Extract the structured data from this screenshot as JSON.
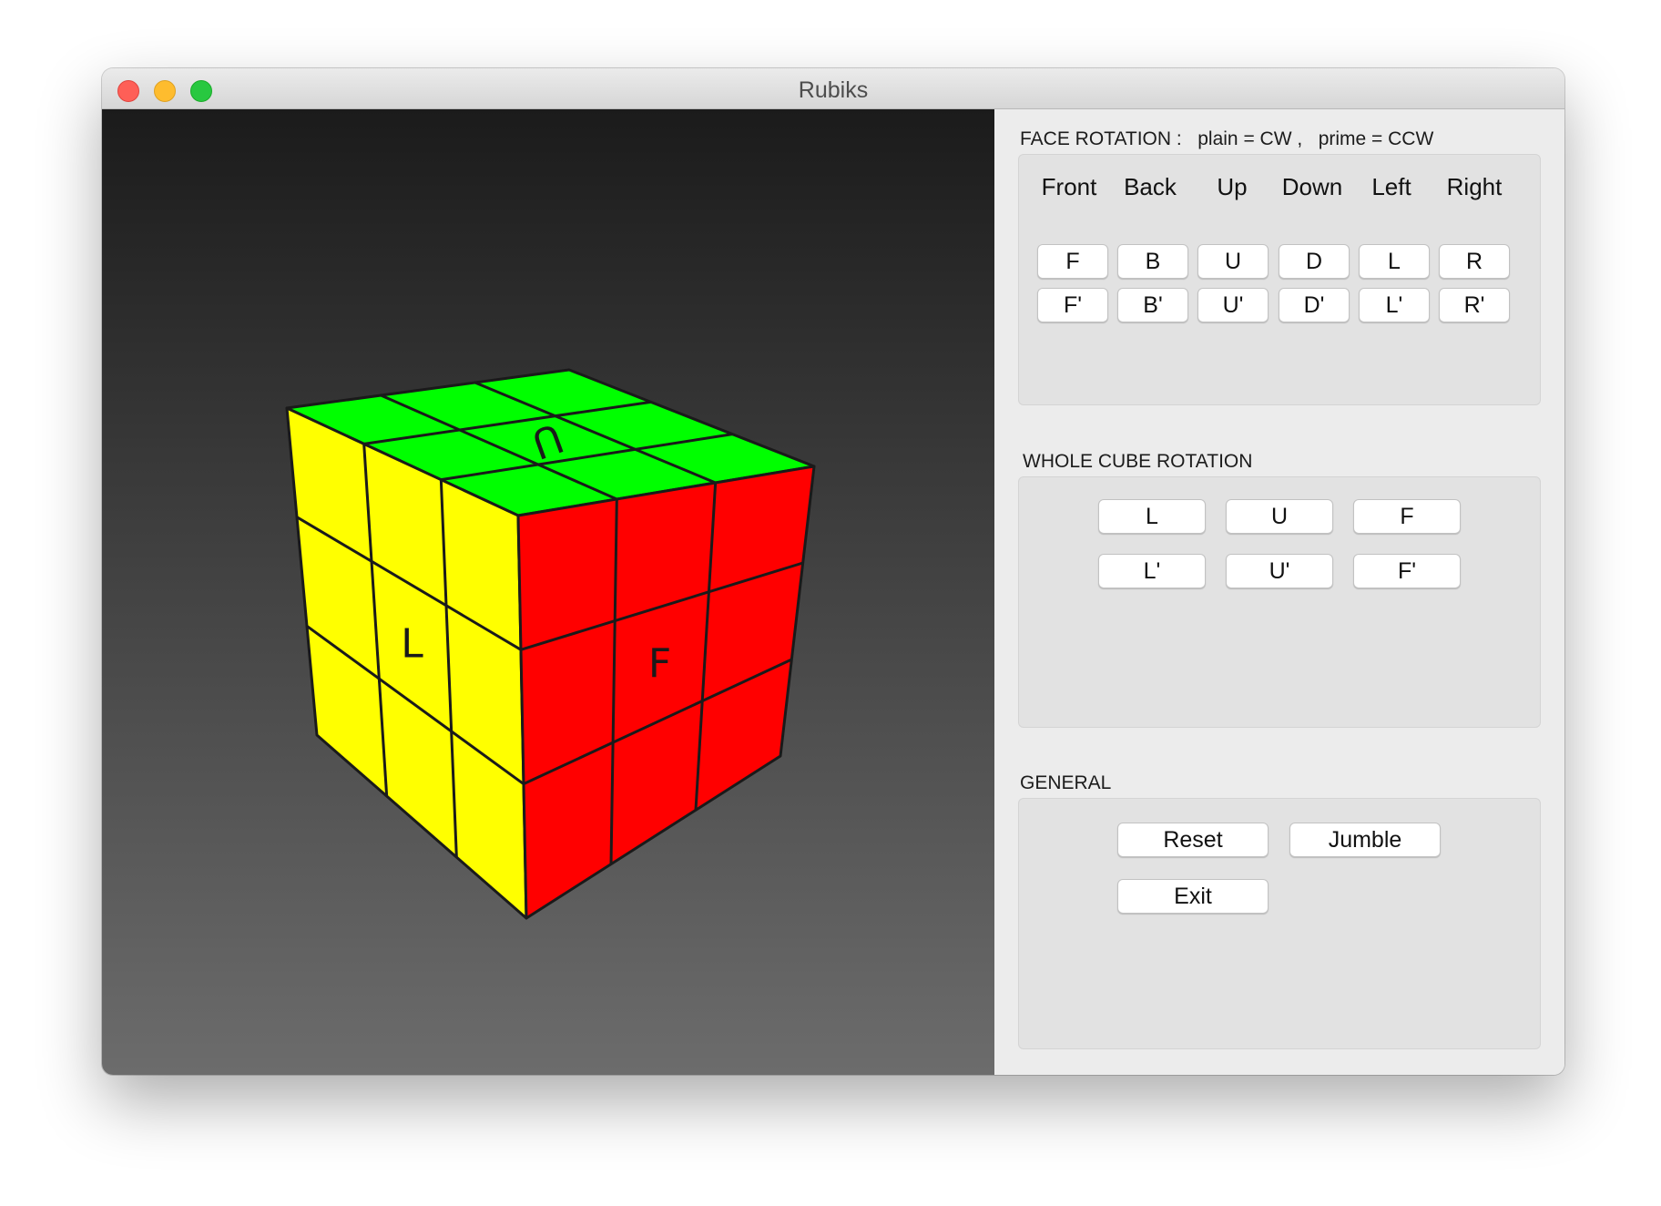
{
  "window": {
    "title": "Rubiks"
  },
  "viewport": {
    "faces": {
      "up": {
        "color": "#00ff00",
        "label": "U"
      },
      "left": {
        "color": "#ffff00",
        "label": "L"
      },
      "front": {
        "color": "#ff0000",
        "label": "F"
      }
    }
  },
  "face_rotation": {
    "heading": "FACE ROTATION :   plain = CW ,   prime = CCW",
    "columns": [
      "Front",
      "Back",
      "Up",
      "Down",
      "Left",
      "Right"
    ],
    "plain": [
      "F",
      "B",
      "U",
      "D",
      "L",
      "R"
    ],
    "prime": [
      "F'",
      "B'",
      "U'",
      "D'",
      "L'",
      "R'"
    ]
  },
  "whole_cube_rotation": {
    "heading": "WHOLE CUBE ROTATION",
    "plain": [
      "L",
      "U",
      "F"
    ],
    "prime": [
      "L'",
      "U'",
      "F'"
    ]
  },
  "general": {
    "heading": "GENERAL",
    "reset_label": "Reset",
    "jumble_label": "Jumble",
    "exit_label": "Exit"
  }
}
